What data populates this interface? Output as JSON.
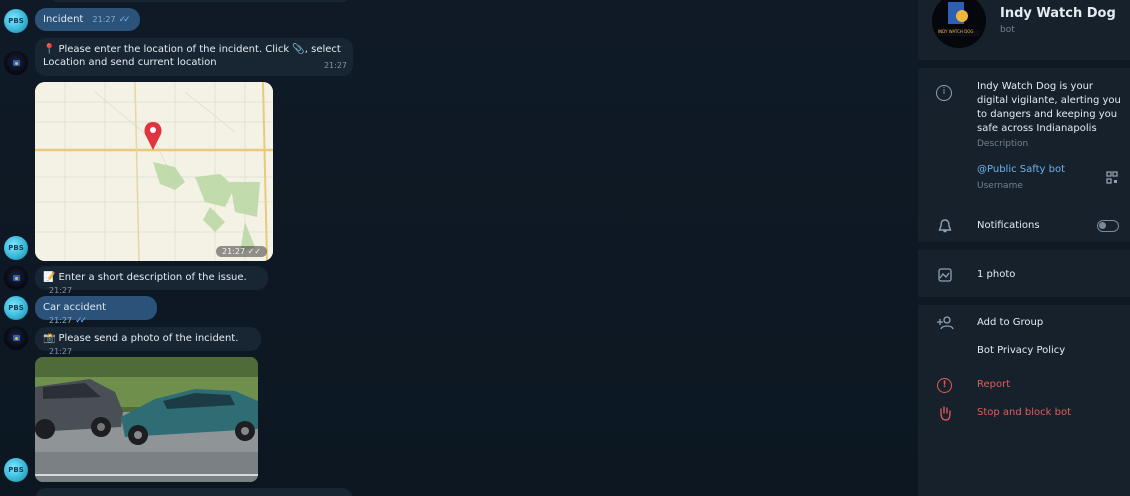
{
  "chat": {
    "messages": [
      {
        "text": "Incident",
        "time": "21:27"
      },
      {
        "emoji": "📍",
        "text": "Please enter the location of the incident. Click 📎, select Location and send current location",
        "time": "21:27"
      },
      {
        "time": "21:27"
      },
      {
        "emoji": "📝",
        "text": "Enter a short description of the issue.",
        "time": "21:27"
      },
      {
        "text": "Car accident",
        "time": "21:27"
      },
      {
        "emoji": "📸",
        "text": "Please send a photo of the incident.",
        "time": "21:27"
      }
    ],
    "user_avatar_text": "PBS",
    "colors": {
      "outgoing": "#2b5278",
      "incoming": "#182533",
      "map_pin": "#e0343f"
    }
  },
  "profile": {
    "name": "Indy Watch Dog",
    "status": "bot",
    "avatar_text": "INDY WATCH DOG",
    "description": "Indy Watch Dog is your digital vigilante, alerting you to dangers and keeping you safe across Indianapolis",
    "description_label": "Description",
    "username": "@Public Safty bot",
    "username_label": "Username",
    "notifications_label": "Notifications",
    "notifications_on": false,
    "photos_label": "1 photo",
    "add_to_group": "Add to Group",
    "privacy_policy": "Bot Privacy Policy",
    "report": "Report",
    "stop_block": "Stop and block bot",
    "icons": [
      "info-icon",
      "qr-code-icon",
      "bell-icon",
      "image-icon",
      "add-user-icon",
      "report-icon",
      "stop-hand-icon"
    ]
  }
}
